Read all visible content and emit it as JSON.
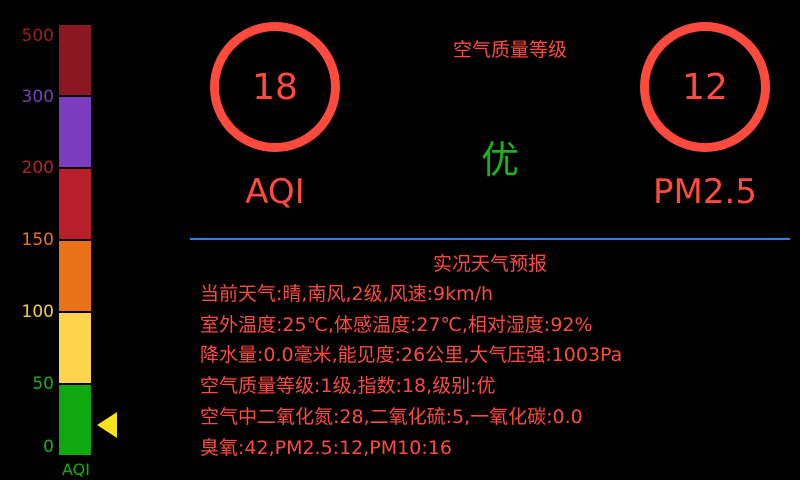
{
  "aqi_scale": {
    "labels": [
      {
        "text": "500",
        "color": "#a11d1d"
      },
      {
        "text": "300",
        "color": "#7a3fbf"
      },
      {
        "text": "200",
        "color": "#b8222a"
      },
      {
        "text": "150",
        "color": "#e9751a"
      },
      {
        "text": "100",
        "color": "#f7cf3f"
      },
      {
        "text": "50",
        "color": "#18b018"
      },
      {
        "text": "0",
        "color": "#18b018"
      }
    ],
    "segments": [
      {
        "color": "#8a1722"
      },
      {
        "color": "#7b3cc0"
      },
      {
        "color": "#b81f2b"
      },
      {
        "color": "#e97117"
      },
      {
        "color": "#fdd44e"
      },
      {
        "color": "#0fa90f"
      }
    ],
    "axis_name": "AQI",
    "pointer_icon": "triangle-pointer-icon"
  },
  "air_quality": {
    "title": "空气质量等级",
    "aqi_value": "18",
    "aqi_label": "AQI",
    "pm25_value": "12",
    "pm25_label": "PM2.5",
    "grade": "优"
  },
  "report": {
    "title": "实况天气预报",
    "lines": [
      "当前天气:晴,南风,2级,风速:9km/h",
      "室外温度:25℃,体感温度:27℃,相对湿度:92%",
      "降水量:0.0毫米,能见度:26公里,大气压强:1003Pa",
      "空气质量等级:1级,指数:18,级别:优",
      "空气中二氧化氮:28,二氧化硫:5,一氧化碳:0.0",
      "臭氧:42,PM2.5:12,PM10:16"
    ]
  },
  "colors": {
    "accent": "#ff4a3d",
    "divider": "#2f7ef0",
    "good": "#17b317",
    "pointer": "#f5e21c"
  }
}
